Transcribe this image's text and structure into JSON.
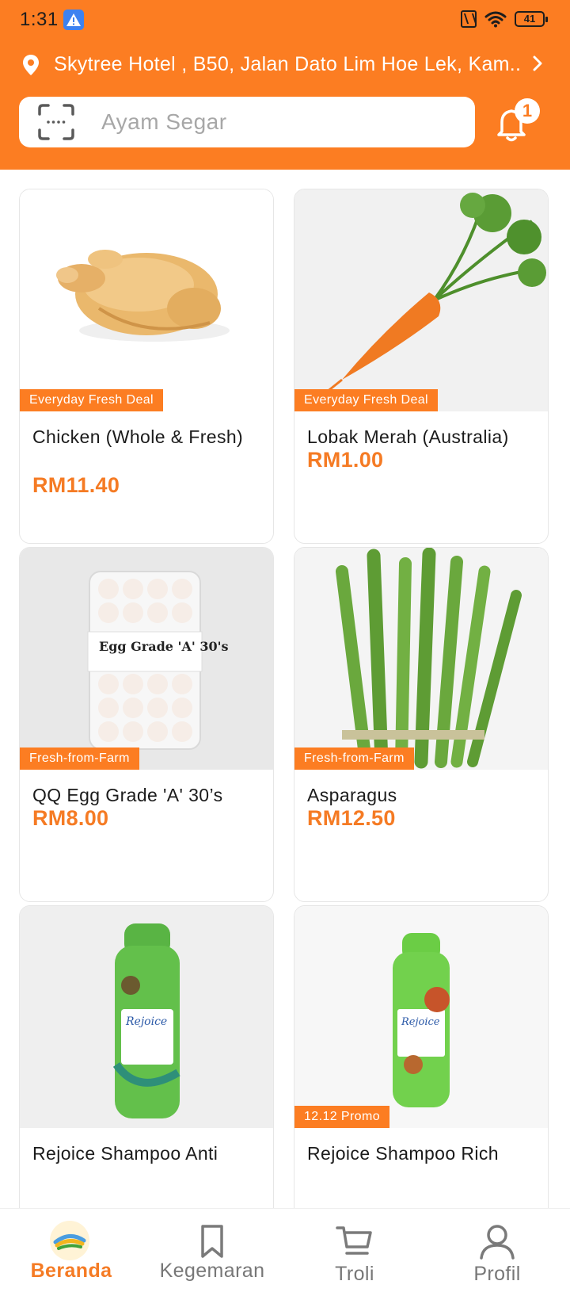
{
  "status_bar": {
    "time": "1:31",
    "battery": "41",
    "icons": [
      "alert-icon",
      "nfc-icon",
      "wifi-icon",
      "battery-icon"
    ]
  },
  "header": {
    "location": "Skytree Hotel , B50, Jalan Dato Lim Hoe Lek, Kam...",
    "search_placeholder": "Ayam Segar",
    "notification_count": "1",
    "accent_color": "#fc7d22"
  },
  "products": [
    {
      "tag": "Everyday Fresh Deal",
      "name": "Chicken (Whole & Fresh)",
      "price": "RM11.40",
      "image": "chicken"
    },
    {
      "tag": "Everyday Fresh Deal",
      "name": "Lobak Merah (Australia)",
      "price": "RM1.00",
      "image": "carrot"
    },
    {
      "tag": "Fresh-from-Farm",
      "name": "QQ Egg Grade 'A' 30’s",
      "price": "RM8.00",
      "image": "egg-tray",
      "image_label": "Egg Grade 'A' 30's"
    },
    {
      "tag": "Fresh-from-Farm",
      "name": "Asparagus",
      "price": "RM12.50",
      "image": "asparagus"
    },
    {
      "tag": "",
      "name": "Rejoice Shampoo Anti",
      "price": "",
      "image": "shampoo",
      "image_label": "Rejoice"
    },
    {
      "tag": "12.12 Promo",
      "name": "Rejoice Shampoo Rich",
      "price": "",
      "image": "shampoo",
      "image_label": "Rejoice"
    }
  ],
  "bottom_nav": [
    {
      "label": "Beranda",
      "icon": "home-logo-icon",
      "active": true
    },
    {
      "label": "Kegemaran",
      "icon": "bookmark-icon",
      "active": false
    },
    {
      "label": "Troli",
      "icon": "cart-icon",
      "active": false
    },
    {
      "label": "Profil",
      "icon": "profile-icon",
      "active": false
    }
  ]
}
